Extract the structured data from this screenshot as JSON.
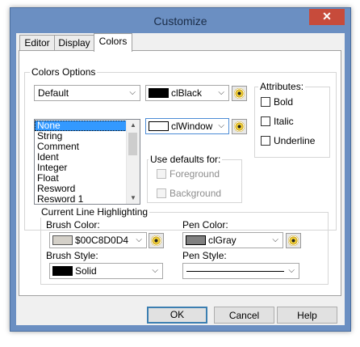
{
  "window": {
    "title": "Customize",
    "close_glyph": "✕"
  },
  "tabs": [
    {
      "label": "Editor",
      "active": false
    },
    {
      "label": "Display",
      "active": false
    },
    {
      "label": "Colors",
      "active": true
    }
  ],
  "colors_options": {
    "group_label": "Colors Options",
    "scheme": {
      "selected": "Default"
    },
    "foreground": {
      "name": "clBlack",
      "swatch": "#000000"
    },
    "background": {
      "name": "clWindow",
      "swatch": "#ffffff"
    },
    "elements": {
      "items": [
        "None",
        "String",
        "Comment",
        "Ident",
        "Integer",
        "Float",
        "Resword",
        "Resword 1"
      ],
      "selected": "None"
    },
    "use_defaults": {
      "label": "Use defaults for:",
      "foreground": {
        "label": "Foreground",
        "checked": false,
        "enabled": false
      },
      "background": {
        "label": "Background",
        "checked": false,
        "enabled": false
      }
    },
    "attributes": {
      "label": "Attributes:",
      "bold": {
        "label": "Bold",
        "checked": false
      },
      "italic": {
        "label": "Italic",
        "checked": false
      },
      "underline": {
        "label": "Underline",
        "checked": false
      }
    }
  },
  "current_line": {
    "group_label": "Current Line Highlighting",
    "brush_color": {
      "label": "Brush Color:",
      "value": "$00C8D0D4",
      "swatch": "#d4d0c8"
    },
    "pen_color": {
      "label": "Pen Color:",
      "value": "clGray",
      "swatch": "#808080"
    },
    "brush_style": {
      "label": "Brush Style:",
      "value": "Solid",
      "swatch": "#000000"
    },
    "pen_style": {
      "label": "Pen Style:"
    }
  },
  "buttons": {
    "ok": "OK",
    "cancel": "Cancel",
    "help": "Help"
  },
  "theme": {
    "titlebar": "#6b8fc2",
    "close": "#c74b3b",
    "selection": "#3399ff"
  }
}
